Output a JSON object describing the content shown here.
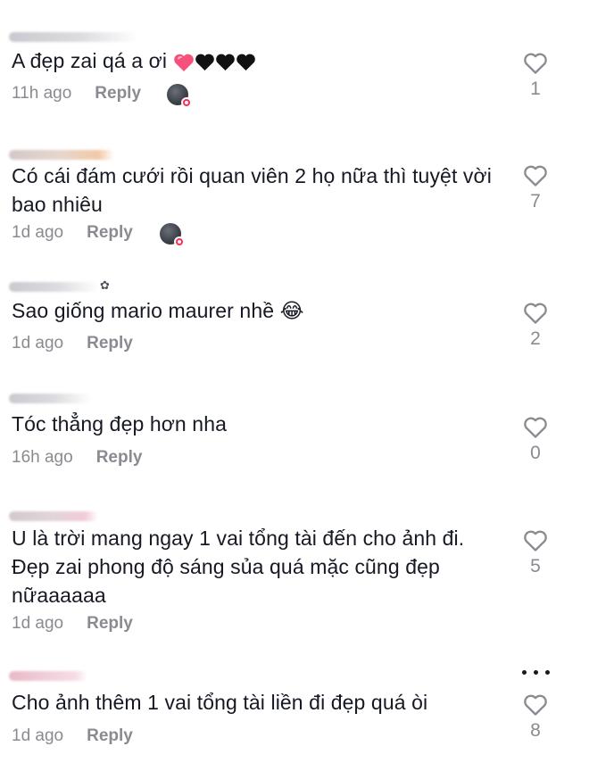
{
  "comments": [
    {
      "text": "A đẹp zai qá a ơi",
      "emoji_suffix": "pink-heart + three black-hearts",
      "time": "11h ago",
      "reply": "Reply",
      "likes": "1",
      "creator_liked": true
    },
    {
      "text": "Có cái đám cưới rồi quan viên 2 họ nữa thì tuyệt vời bao nhiêu",
      "time": "1d ago",
      "reply": "Reply",
      "likes": "7",
      "creator_liked": true
    },
    {
      "text": "Sao giống mario maurer nhề 😂",
      "time": "1d ago",
      "reply": "Reply",
      "likes": "2",
      "creator_liked": false
    },
    {
      "text": "Tóc thẳng đẹp hơn nha",
      "time": "16h ago",
      "reply": "Reply",
      "likes": "0",
      "creator_liked": false
    },
    {
      "text": "U là trời mang ngay 1 vai tổng tài đến cho ảnh đi. Đẹp zai phong độ sáng sủa quá mặc cũng đẹp nữaaaaaa",
      "time": "1d ago",
      "reply": "Reply",
      "likes": "5",
      "creator_liked": false
    },
    {
      "text": "Cho ảnh thêm 1 vai tổng tài liền đi đẹp quá òi",
      "time": "1d ago",
      "reply": "Reply",
      "likes": "8",
      "creator_liked": false
    }
  ],
  "icons": {
    "like": "heart-outline-icon",
    "more": "more-options-icon",
    "creator_avatar": "creator-avatar-icon"
  },
  "colors": {
    "text": "#161823",
    "meta": "#8a8b91",
    "accent": "#fe2c55"
  }
}
